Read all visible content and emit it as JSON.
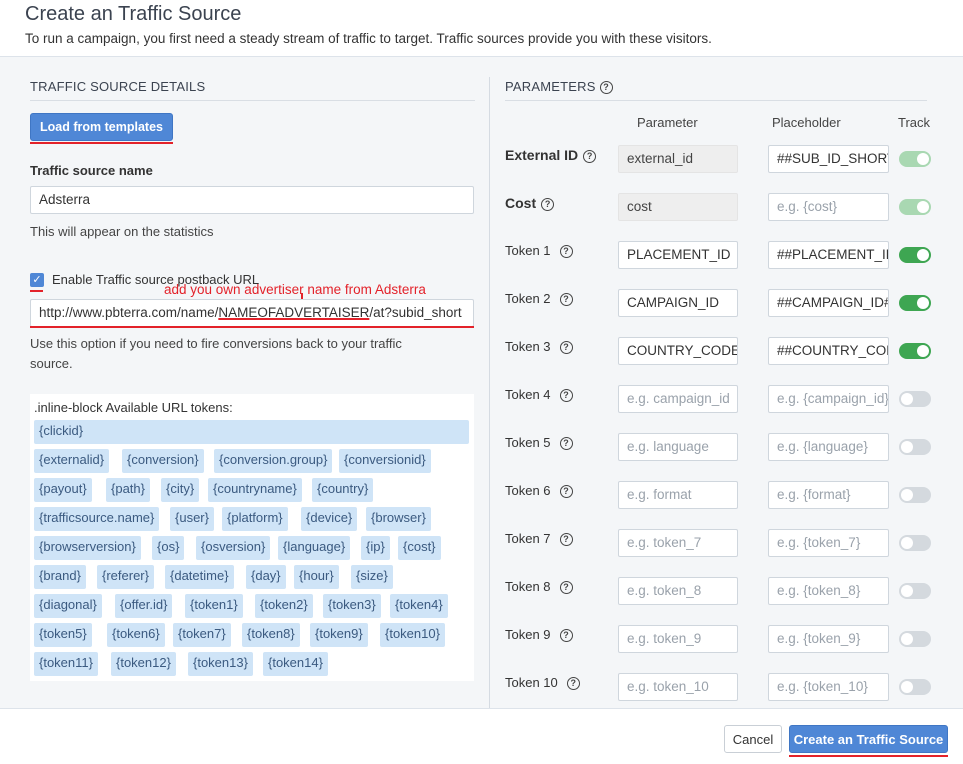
{
  "header": {
    "title": "Create an Traffic Source",
    "subtitle": "To run a campaign, you first need a steady stream of traffic to target. Traffic sources provide you with these visitors."
  },
  "details": {
    "section_title": "TRAFFIC SOURCE DETAILS",
    "load_button": "Load from templates",
    "name_label": "Traffic source name",
    "name_value": "Adsterra",
    "name_help": "This will appear on the statistics",
    "postback_checkbox_label": "Enable Traffic source postback URL",
    "postback_checked": true,
    "annotation": "add you own advertiser name from Adsterra",
    "postback_url_prefix": "http://www.pbterra.com/name/",
    "postback_url_highlight": "NAMEOFADVERTAISER",
    "postback_url_suffix": "/at?subid_short",
    "postback_help_line1": "Use this option if you need to fire conversions back to your traffic",
    "postback_help_line2": "source.",
    "tokens_heading": ".inline-block Available URL tokens:",
    "tokens": [
      "{clickid}",
      "{externalid}",
      "{conversion}",
      "{conversion.group}",
      "{conversionid}",
      "{payout}",
      "{path}",
      "{city}",
      "{countryname}",
      "{country}",
      "{trafficsource.name}",
      "{user}",
      "{platform}",
      "{device}",
      "{browser}",
      "{browserversion}",
      "{os}",
      "{osversion}",
      "{language}",
      "{ip}",
      "{cost}",
      "{brand}",
      "{referer}",
      "{datetime}",
      "{day}",
      "{hour}",
      "{size}",
      "{diagonal}",
      "{offer.id}",
      "{token1}",
      "{token2}",
      "{token3}",
      "{token4}",
      "{token5}",
      "{token6}",
      "{token7}",
      "{token8}",
      "{token9}",
      "{token10}",
      "{token11}",
      "{token12}",
      "{token13}",
      "{token14}"
    ]
  },
  "parameters": {
    "section_title": "PARAMETERS",
    "col_parameter": "Parameter",
    "col_placeholder": "Placeholder",
    "col_track": "Track",
    "rows": [
      {
        "label": "External ID",
        "parameter": "external_id",
        "placeholder": "##SUB_ID_SHORT##",
        "param_is_placeholder": false,
        "ph_is_placeholder": false,
        "track": "disabled-on"
      },
      {
        "label": "Cost",
        "parameter": "cost",
        "placeholder": "e.g. {cost}",
        "param_is_placeholder": false,
        "ph_is_placeholder": true,
        "track": "disabled-on"
      },
      {
        "label": "Token 1",
        "parameter": "PLACEMENT_ID",
        "placeholder": "##PLACEMENT_ID##",
        "param_is_placeholder": false,
        "ph_is_placeholder": false,
        "track": "on"
      },
      {
        "label": "Token 2",
        "parameter": "CAMPAIGN_ID",
        "placeholder": "##CAMPAIGN_ID##",
        "param_is_placeholder": false,
        "ph_is_placeholder": false,
        "track": "on"
      },
      {
        "label": "Token 3",
        "parameter": "COUNTRY_CODE",
        "placeholder": "##COUNTRY_CODE##",
        "param_is_placeholder": false,
        "ph_is_placeholder": false,
        "track": "on"
      },
      {
        "label": "Token 4",
        "parameter": "e.g. campaign_id",
        "placeholder": "e.g. {campaign_id}",
        "param_is_placeholder": true,
        "ph_is_placeholder": true,
        "track": "off"
      },
      {
        "label": "Token 5",
        "parameter": "e.g. language",
        "placeholder": "e.g. {language}",
        "param_is_placeholder": true,
        "ph_is_placeholder": true,
        "track": "off"
      },
      {
        "label": "Token 6",
        "parameter": "e.g. format",
        "placeholder": "e.g. {format}",
        "param_is_placeholder": true,
        "ph_is_placeholder": true,
        "track": "off"
      },
      {
        "label": "Token 7",
        "parameter": "e.g. token_7",
        "placeholder": "e.g. {token_7}",
        "param_is_placeholder": true,
        "ph_is_placeholder": true,
        "track": "off"
      },
      {
        "label": "Token 8",
        "parameter": "e.g. token_8",
        "placeholder": "e.g. {token_8}",
        "param_is_placeholder": true,
        "ph_is_placeholder": true,
        "track": "off"
      },
      {
        "label": "Token 9",
        "parameter": "e.g. token_9",
        "placeholder": "e.g. {token_9}",
        "param_is_placeholder": true,
        "ph_is_placeholder": true,
        "track": "off"
      },
      {
        "label": "Token 10",
        "parameter": "e.g. token_10",
        "placeholder": "e.g. {token_10}",
        "param_is_placeholder": true,
        "ph_is_placeholder": true,
        "track": "off"
      }
    ]
  },
  "footer": {
    "cancel_label": "Cancel",
    "create_label": "Create an Traffic Source"
  },
  "colors": {
    "primary": "#4f87d6",
    "toggle_on": "#3ea652",
    "annotation": "#e3222a",
    "token_bg": "#cfe4f7"
  }
}
